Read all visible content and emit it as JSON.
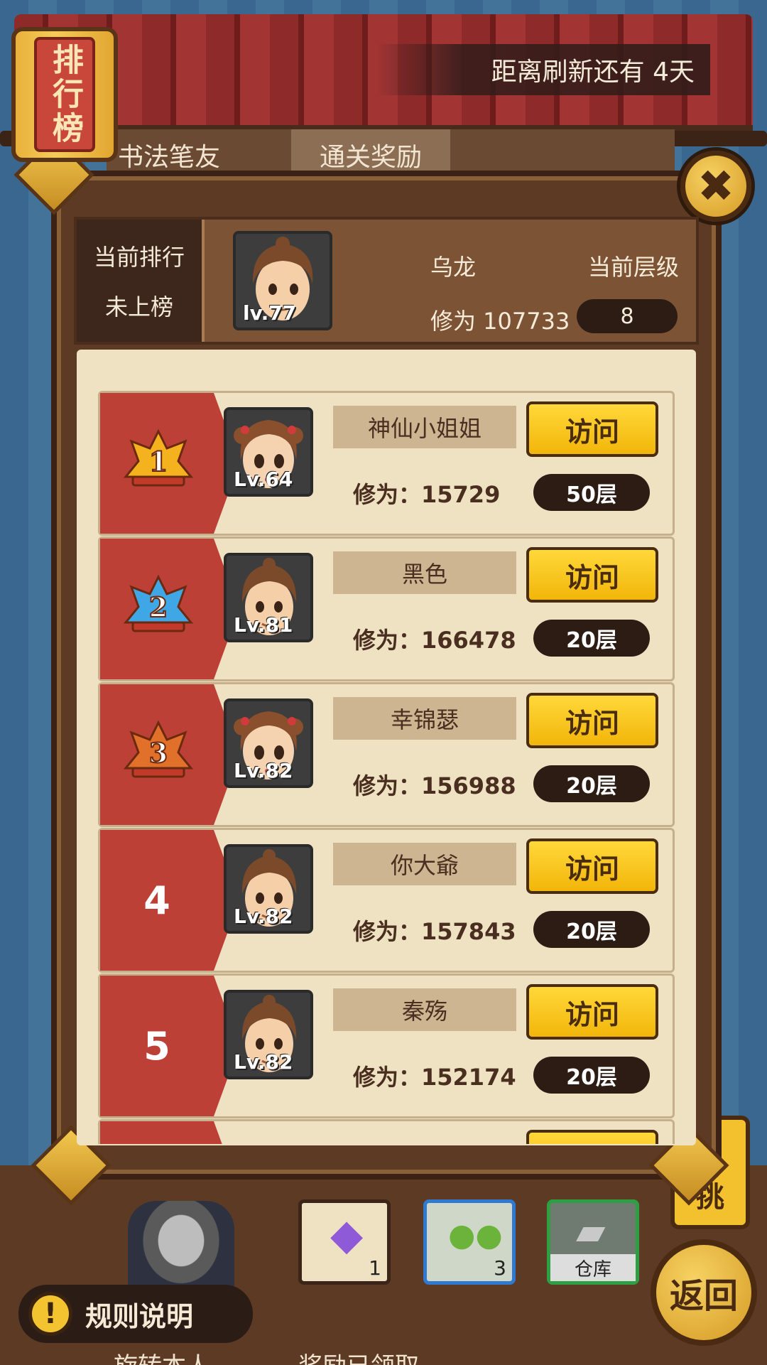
{
  "header": {
    "title": "排行榜",
    "refresh_text": "距离刷新还有  4天",
    "back_tabs": [
      "书法笔友",
      "通关奖励"
    ]
  },
  "my_rank": {
    "rank_label": "当前排行",
    "rank_value": "未上榜",
    "name": "乌龙",
    "level_badge": "lv.77",
    "score_text": "修为  107733",
    "level_label": "当前层级",
    "level_value": "8"
  },
  "visit_label": "访问",
  "leaderboard": [
    {
      "rank": "1",
      "name": "神仙小姐姐",
      "lv": "Lv.64",
      "score": "修为：15729",
      "floor": "50层",
      "avatar": "female",
      "medal_color": "#f4b21e"
    },
    {
      "rank": "2",
      "name": "黑色",
      "lv": "Lv.81",
      "score": "修为：166478",
      "floor": "20层",
      "avatar": "male",
      "medal_color": "#3fa7e6"
    },
    {
      "rank": "3",
      "name": "幸锦瑟",
      "lv": "Lv.82",
      "score": "修为：156988",
      "floor": "20层",
      "avatar": "female",
      "medal_color": "#e0702a"
    },
    {
      "rank": "4",
      "name": "你大爺",
      "lv": "Lv.82",
      "score": "修为：157843",
      "floor": "20层",
      "avatar": "male",
      "medal_color": ""
    },
    {
      "rank": "5",
      "name": "秦殇",
      "lv": "Lv.82",
      "score": "修为：152174",
      "floor": "20层",
      "avatar": "male",
      "medal_color": ""
    }
  ],
  "inventory": [
    {
      "icon": "purple-crystal-icon",
      "count": "1",
      "border": "#3a2518"
    },
    {
      "icon": "green-beans-icon",
      "count": "3",
      "border": "#2f7ad0"
    },
    {
      "icon": "warehouse-icon",
      "count": "",
      "label": "仓库",
      "border": "#2ea043"
    }
  ],
  "footer": {
    "rules_label": "规则说明",
    "back_label": "返回",
    "side_label": "挑",
    "bottom_left": "旋转本人",
    "bottom_right": "奖励已领取"
  }
}
